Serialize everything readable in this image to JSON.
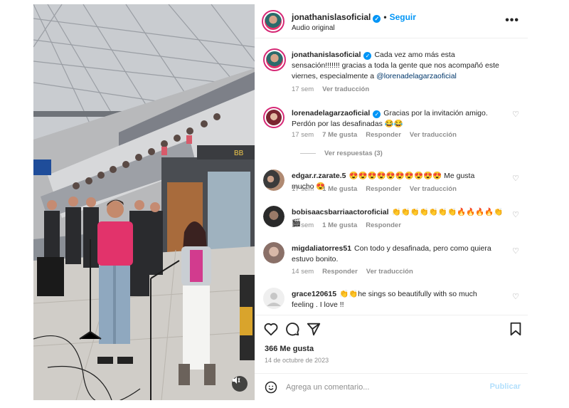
{
  "post": {
    "username": "jonathanislasoficial",
    "follow_label": "Seguir",
    "audio_label": "Audio original",
    "more_label": "•••"
  },
  "caption": {
    "username": "jonathanislasoficial",
    "text": "Cada vez amo más esta sensación!!!!!!! gracias a toda la gente que nos acompañó este viernes, especialmente a ",
    "mention": "@lorenadelagarzaoficial",
    "time": "17 sem",
    "translate": "Ver traducción"
  },
  "comments": [
    {
      "username": "lorenadelagarzaoficial",
      "text": "Gracias por la invitación amigo. Perdón por las desafinadas 😂😂",
      "time": "17 sem",
      "likes": "7 Me gusta",
      "reply": "Responder",
      "translate": "Ver traducción",
      "avatar_color": "#b33a4a"
    },
    {
      "username": "edgar.r.zarate.5",
      "text": "😍😍😍😍😍😍😍😍😍😍 Me gusta mucho 😍",
      "time": "17 sem",
      "likes": "1 Me gusta",
      "reply": "Responder",
      "translate": "Ver traducción",
      "avatar_color": "#3b3b3b"
    },
    {
      "username": "bobisaacsbarriaactoroficial",
      "text": "👏👏👏👏👏👏👏🔥🔥🔥🔥👏🎬",
      "time": "17 sem",
      "likes": "1 Me gusta",
      "reply": "Responder",
      "avatar_color": "#2a2a2a"
    },
    {
      "username": "migdaliatorres51",
      "text": "Con todo y desafinada, pero como quiera estuvo bonito.",
      "time": "14 sem",
      "reply": "Responder",
      "translate": "Ver traducción",
      "avatar_color": "#a08a82"
    },
    {
      "username": "grace120615",
      "text": "👏👏he sings so beautifully with so much feeling . I love !!",
      "avatar_color": "#dbdbdb"
    }
  ],
  "replies_label": "Ver respuestas (3)",
  "likes_count": "366 Me gusta",
  "post_date": "14 de octubre de 2023",
  "composer": {
    "placeholder": "Agrega un comentario...",
    "post_label": "Publicar"
  },
  "colors": {
    "accent": "#0095f6",
    "muted": "#8e8e8e",
    "shirt": "#e2336b"
  },
  "icons": [
    "verified-icon",
    "heart-icon",
    "comment-icon",
    "share-icon",
    "bookmark-icon",
    "emoji-icon",
    "mute-icon"
  ]
}
